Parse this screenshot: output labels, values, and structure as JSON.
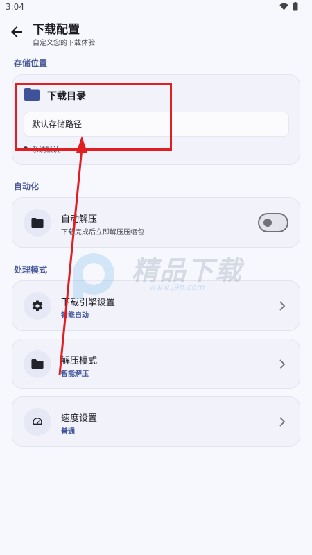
{
  "status_bar": {
    "time": "3:04",
    "icons": [
      "wifi-icon",
      "battery-icon"
    ]
  },
  "header": {
    "title": "下载配置",
    "subtitle": "自定义您的下载体验"
  },
  "sections": {
    "storage": {
      "label": "存储位置"
    },
    "automation": {
      "label": "自动化"
    },
    "processing": {
      "label": "处理模式"
    }
  },
  "storage_card": {
    "icon": "folder-icon",
    "title": "下载目录",
    "path_placeholder": "默认存储路径",
    "source_label": "系统默认"
  },
  "auto_extract": {
    "icon": "folder-icon",
    "title": "自动解压",
    "description": "下载完成后立即解压压缩包",
    "enabled": false
  },
  "processing_items": [
    {
      "icon": "gear-icon",
      "title": "下载引擎设置",
      "value": "智能自动"
    },
    {
      "icon": "folder-icon",
      "title": "解压模式",
      "value": "智能解压"
    },
    {
      "icon": "speedometer-icon",
      "title": "速度设置",
      "value": "普通"
    }
  ],
  "annotation": {
    "color": "#e01f23"
  },
  "watermark": {
    "brand": "精品下载",
    "url": "www.j9p.com"
  },
  "colors": {
    "accent": "#3d5299",
    "background": "#f7f8fd",
    "card": "#f2f3fa",
    "highlight": "#e01f23"
  }
}
